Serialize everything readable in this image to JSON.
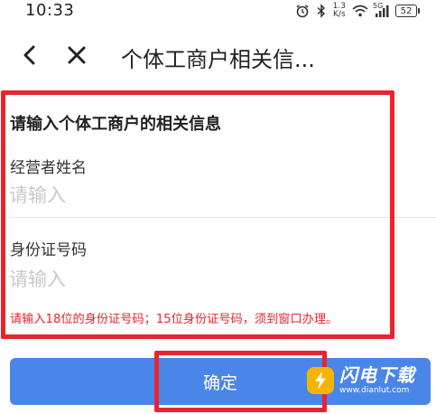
{
  "status_bar": {
    "time": "10:33",
    "net_speed_value": "1.3",
    "net_speed_unit": "K/s",
    "network_type": "5G",
    "battery": "52",
    "icons": [
      "alarm-icon",
      "bluetooth-icon",
      "wifi-icon",
      "signal-icon",
      "battery-icon"
    ]
  },
  "header": {
    "title": "个体工商户相关信..."
  },
  "form": {
    "heading": "请输入个体工商户的相关信息",
    "name_label": "经营者姓名",
    "name_placeholder": "请输入",
    "name_value": "",
    "id_label": "身份证号码",
    "id_placeholder": "请输入",
    "id_value": "",
    "hint": "请输入18位的身份证号码；15位身份证号码，须到窗口办理。"
  },
  "confirm_button": {
    "label": "确定"
  },
  "watermark": {
    "title": "闪电下载",
    "url": "www.dianlut.com"
  },
  "colors": {
    "accent": "#4a86e8",
    "highlight": "#e8242f",
    "hint": "#e8242f",
    "placeholder": "#c9c9c9"
  }
}
